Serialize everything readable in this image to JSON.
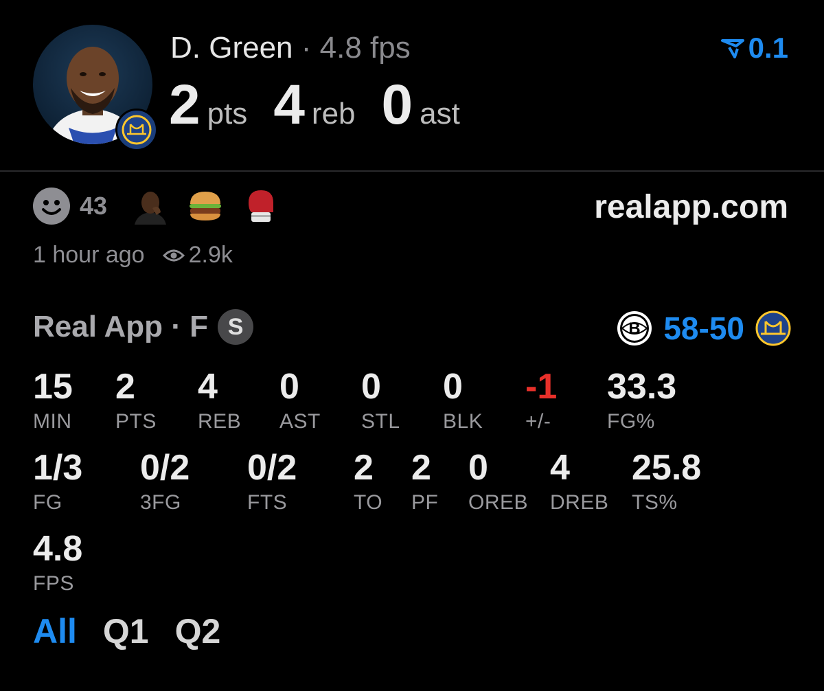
{
  "player": {
    "name": "D. Green",
    "separator": "·",
    "fps": "4.8 fps",
    "summary": [
      {
        "value": "2",
        "unit": "pts"
      },
      {
        "value": "4",
        "unit": "reb"
      },
      {
        "value": "0",
        "unit": "ast"
      }
    ],
    "delta": "0.1"
  },
  "social": {
    "reaction_count": "43",
    "site": "realapp.com",
    "time_ago": "1 hour ago",
    "views": "2.9k"
  },
  "game": {
    "title": "Real App · F",
    "badge": "S",
    "score_home": "58",
    "score_sep": "-",
    "score_away": "50"
  },
  "stats": {
    "row1": [
      {
        "value": "15",
        "label": "MIN"
      },
      {
        "value": "2",
        "label": "PTS"
      },
      {
        "value": "4",
        "label": "REB"
      },
      {
        "value": "0",
        "label": "AST"
      },
      {
        "value": "0",
        "label": "STL"
      },
      {
        "value": "0",
        "label": "BLK"
      },
      {
        "value": "-1",
        "label": "+/-"
      },
      {
        "value": "33.3",
        "label": "FG%"
      }
    ],
    "row2": [
      {
        "value": "1/3",
        "label": "FG"
      },
      {
        "value": "0/2",
        "label": "3FG"
      },
      {
        "value": "0/2",
        "label": "FTS"
      },
      {
        "value": "2",
        "label": "TO"
      },
      {
        "value": "2",
        "label": "PF"
      },
      {
        "value": "0",
        "label": "OREB"
      },
      {
        "value": "4",
        "label": "DREB"
      },
      {
        "value": "25.8",
        "label": "TS%"
      }
    ],
    "row3": [
      {
        "value": "4.8",
        "label": "FPS"
      }
    ]
  },
  "tabs": [
    "All",
    "Q1",
    "Q2"
  ],
  "colors": {
    "accent": "#1e8bf0",
    "negative": "#e8302a",
    "background": "#000000"
  },
  "icons": [
    "player-avatar",
    "warriors-logo-icon",
    "delta-arrow-icon",
    "smiley-icon",
    "face-palm-emoji",
    "burger-emoji",
    "boxing-glove-emoji",
    "eye-icon",
    "nets-logo-icon"
  ]
}
